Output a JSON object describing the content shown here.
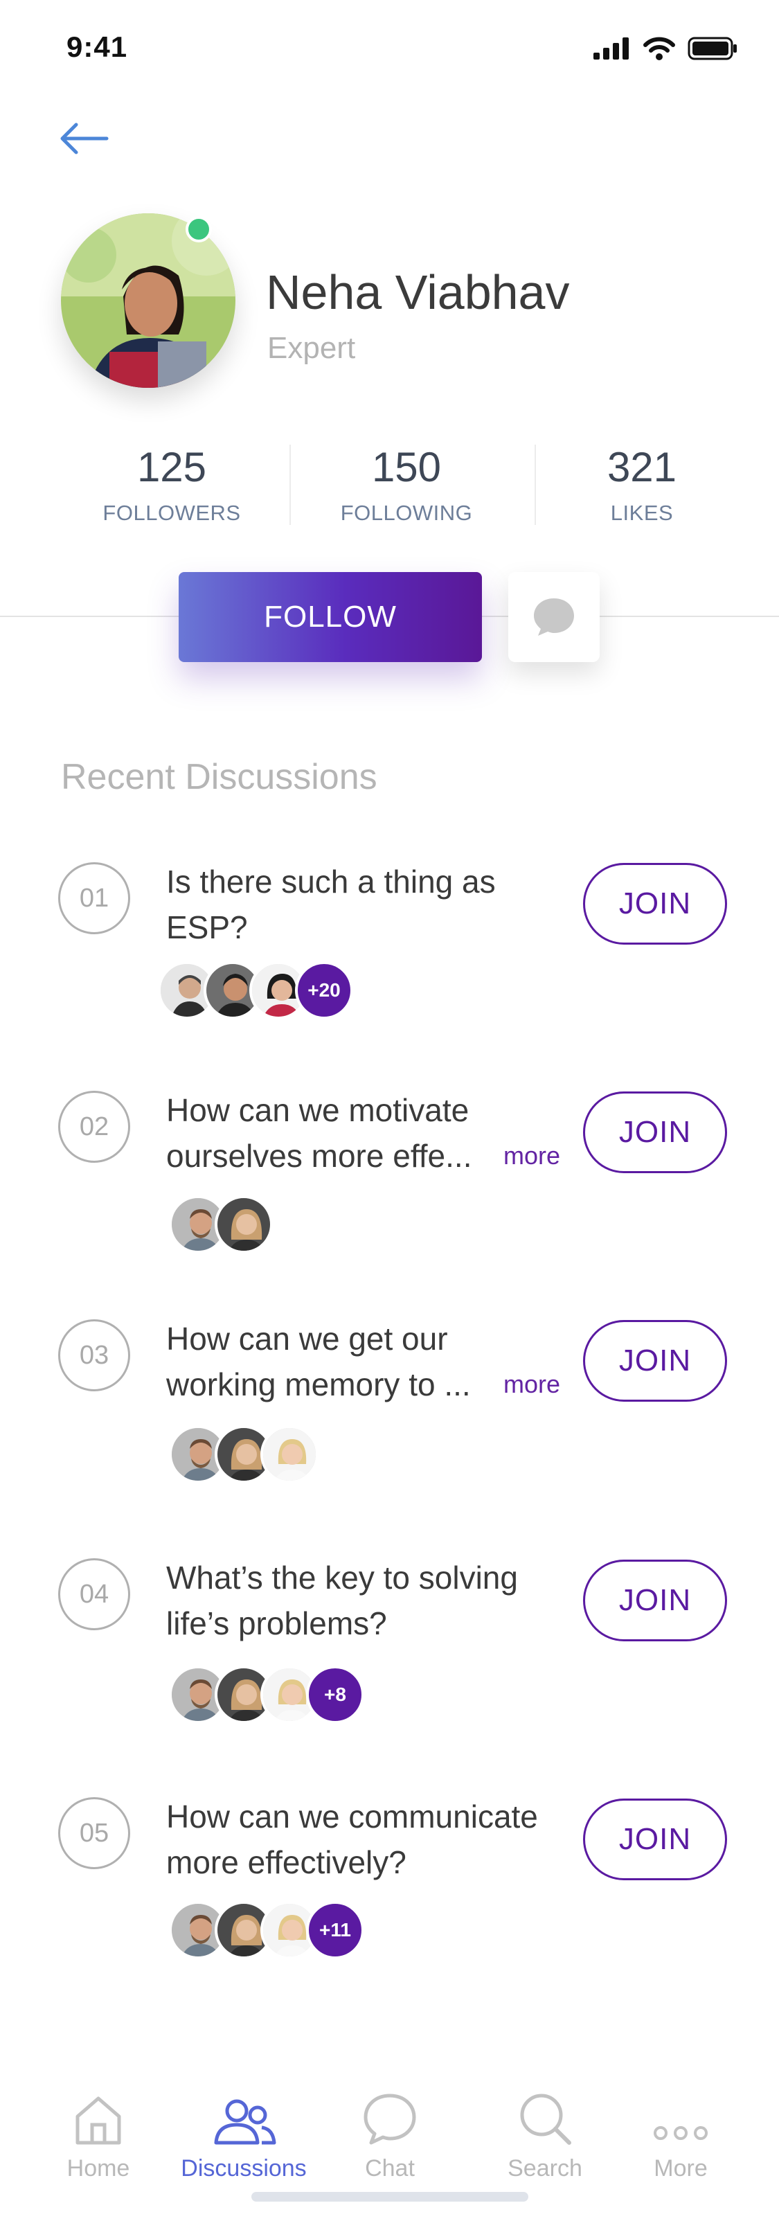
{
  "status_bar": {
    "time": "9:41"
  },
  "profile": {
    "name": "Neha Viabhav",
    "role": "Expert",
    "stats": [
      {
        "value": "125",
        "label": "FOLLOWERS"
      },
      {
        "value": "150",
        "label": "FOLLOWING"
      },
      {
        "value": "321",
        "label": "LIKES"
      }
    ],
    "follow_label": "FOLLOW"
  },
  "section_title": "Recent Discussions",
  "join_label": "JOIN",
  "more_label": "more",
  "discussions": [
    {
      "number": "01",
      "line1": "Is there such a thing as",
      "line2": "ESP?",
      "more": false,
      "extra": "+20"
    },
    {
      "number": "02",
      "line1": "How can we motivate",
      "line2": "ourselves more effe...",
      "more": true,
      "extra": ""
    },
    {
      "number": "03",
      "line1": "How can we get our",
      "line2": "working memory to ...",
      "more": true,
      "extra": ""
    },
    {
      "number": "04",
      "line1": "What’s the key to solving",
      "line2": "life’s problems?",
      "more": false,
      "extra": "+8"
    },
    {
      "number": "05",
      "line1": "How can we communicate",
      "line2": "more effectively?",
      "more": false,
      "extra": "+11"
    }
  ],
  "tabs": [
    {
      "label": "Home",
      "icon": "home-icon"
    },
    {
      "label": "Discussions",
      "icon": "people-icon"
    },
    {
      "label": "Chat",
      "icon": "chat-bubble-icon"
    },
    {
      "label": "Search",
      "icon": "search-icon"
    },
    {
      "label": "More",
      "icon": "more-dots-icon"
    }
  ],
  "colors": {
    "accent": "#5a1aa1",
    "active_tab": "#5566d6",
    "online": "#3bc67e"
  }
}
